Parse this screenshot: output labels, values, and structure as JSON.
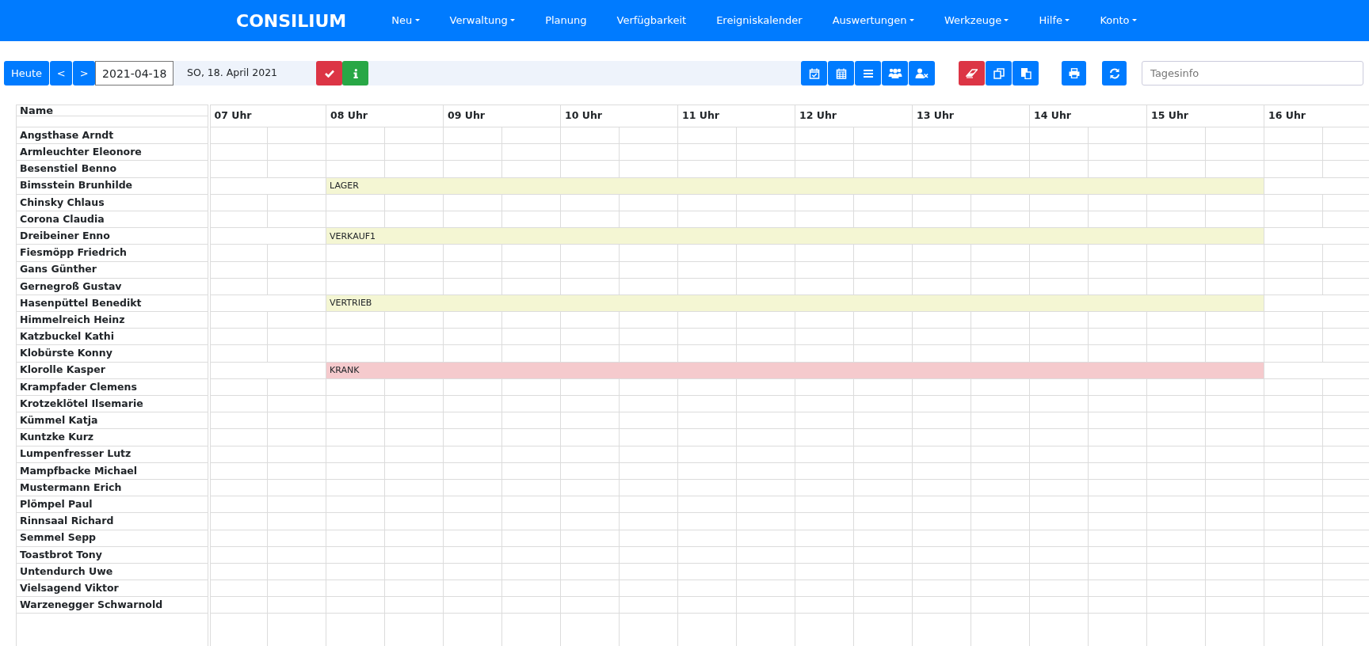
{
  "brand": "CONSILIUM",
  "nav": [
    {
      "label": "Neu",
      "dropdown": true
    },
    {
      "label": "Verwaltung",
      "dropdown": true
    },
    {
      "label": "Planung",
      "dropdown": false
    },
    {
      "label": "Verfügbarkeit",
      "dropdown": false
    },
    {
      "label": "Ereigniskalender",
      "dropdown": false
    },
    {
      "label": "Auswertungen",
      "dropdown": true
    },
    {
      "label": "Werkzeuge",
      "dropdown": true
    },
    {
      "label": "Hilfe",
      "dropdown": true
    },
    {
      "label": "Konto",
      "dropdown": true
    }
  ],
  "toolbar": {
    "today": "Heute",
    "prev": "<",
    "next": ">",
    "date": "2021-04-18",
    "date_text": "SO, 18. April 2021",
    "info_placeholder": "Tagesinfo"
  },
  "schedule": {
    "name_header": "Name",
    "hours": [
      "07 Uhr",
      "08 Uhr",
      "09 Uhr",
      "10 Uhr",
      "11 Uhr",
      "12 Uhr",
      "13 Uhr",
      "14 Uhr",
      "15 Uhr",
      "16 Uhr"
    ],
    "rows": [
      {
        "name": "Angsthase Arndt"
      },
      {
        "name": "Armleuchter Eleonore"
      },
      {
        "name": "Besenstiel Benno"
      },
      {
        "name": "Bimsstein Brunhilde",
        "entry": {
          "label": "LAGER",
          "color": "#f4f6d3",
          "hours": [
            false,
            true,
            true,
            true,
            true,
            true,
            true,
            true,
            true,
            false
          ]
        }
      },
      {
        "name": "Chinsky Chlaus"
      },
      {
        "name": "Corona Claudia"
      },
      {
        "name": "Dreibeiner Enno",
        "entry": {
          "label": "VERKAUF1",
          "color": "#f4f6d3",
          "hours": [
            false,
            true,
            true,
            true,
            true,
            true,
            true,
            true,
            true,
            false
          ]
        }
      },
      {
        "name": "Fiesmöpp Friedrich"
      },
      {
        "name": "Gans Günther"
      },
      {
        "name": "Gernegroß Gustav"
      },
      {
        "name": "Hasenpüttel Benedikt",
        "entry": {
          "label": "VERTRIEB",
          "color": "#f4f6d3",
          "hours": [
            false,
            true,
            true,
            true,
            true,
            true,
            true,
            true,
            true,
            false
          ]
        }
      },
      {
        "name": "Himmelreich Heinz"
      },
      {
        "name": "Katzbuckel Kathi"
      },
      {
        "name": "Klobürste Konny"
      },
      {
        "name": "Klorolle Kasper",
        "entry": {
          "label": "KRANK",
          "color": "#f5cacd",
          "hours": [
            false,
            true,
            true,
            true,
            true,
            true,
            true,
            true,
            true,
            false
          ]
        }
      },
      {
        "name": "Krampfader Clemens"
      },
      {
        "name": "Krotzeklötel Ilsemarie"
      },
      {
        "name": "Kümmel Katja"
      },
      {
        "name": "Kuntzke Kurz"
      },
      {
        "name": "Lumpenfresser Lutz"
      },
      {
        "name": "Mampfbacke Michael"
      },
      {
        "name": "Mustermann Erich"
      },
      {
        "name": "Plömpel Paul"
      },
      {
        "name": "Rinnsaal Richard"
      },
      {
        "name": "Semmel Sepp"
      },
      {
        "name": "Toastbrot Tony"
      },
      {
        "name": "Untendurch Uwe"
      },
      {
        "name": "Vielsagend Viktor"
      },
      {
        "name": "Warzenegger Schwarnold"
      }
    ]
  }
}
